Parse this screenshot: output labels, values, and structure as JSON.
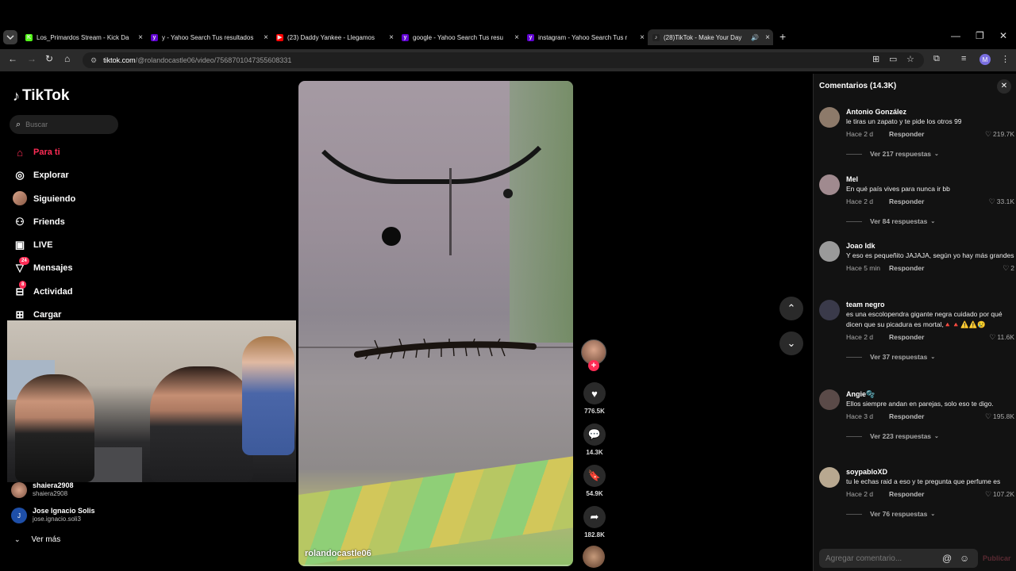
{
  "browser": {
    "tabs": [
      {
        "title": "Los_Primardos Stream - Kick Da",
        "favicon_color": "#53fc18",
        "favicon_glyph": "K"
      },
      {
        "title": "y - Yahoo Search Tus resultados",
        "favicon_color": "#6001d2",
        "favicon_glyph": "y"
      },
      {
        "title": "(23) Daddy Yankee - Llegamos",
        "favicon_color": "#ff0000",
        "favicon_glyph": "▶"
      },
      {
        "title": "google - Yahoo Search Tus resu",
        "favicon_color": "#6001d2",
        "favicon_glyph": "y"
      },
      {
        "title": "instagram - Yahoo Search Tus r",
        "favicon_color": "#6001d2",
        "favicon_glyph": "y"
      },
      {
        "title": "(28)TikTok - Make Your Day",
        "favicon_color": "#222222",
        "favicon_glyph": "♪",
        "active": true
      }
    ],
    "url_host": "tiktok.com",
    "url_path": "/@rolandocastle06/video/7568701047355608331",
    "profile_initial": "M"
  },
  "tiktok": {
    "logo": "TikTok",
    "search_placeholder": "Buscar",
    "nav": [
      {
        "label": "Para ti",
        "icon": "home-icon",
        "active": true
      },
      {
        "label": "Explorar",
        "icon": "compass-icon"
      },
      {
        "label": "Siguiendo",
        "icon": "avatar"
      },
      {
        "label": "Friends",
        "icon": "friends-icon"
      },
      {
        "label": "LIVE",
        "icon": "live-icon"
      },
      {
        "label": "Mensajes",
        "icon": "messages-icon",
        "badge": "24"
      },
      {
        "label": "Actividad",
        "icon": "activity-icon",
        "badge": "8"
      },
      {
        "label": "Cargar",
        "icon": "upload-icon"
      }
    ],
    "following": [
      {
        "name": "shaiera2908",
        "handle": "shaiera2908"
      },
      {
        "name": "Jose Ignacio Solis",
        "handle": "jose.ignacio.soli3",
        "initial": "J"
      }
    ],
    "see_more": "Ver más",
    "video": {
      "caption": "rolandocastle06",
      "likes": "776.5K",
      "comments": "14.3K",
      "saves": "54.9K",
      "shares": "182.8K"
    },
    "comments_panel": {
      "title": "Comentarios (14.3K)",
      "reply_label": "Responder",
      "input_placeholder": "Agregar comentario...",
      "publish_label": "Publicar",
      "items": [
        {
          "user": "Antonio González",
          "text": "le tiras un zapato y te pide los otros 99",
          "when": "Hace 2 d",
          "likes": "219.7K",
          "replies": "Ver 217 respuestas",
          "avatar_color": "#8d7a6a"
        },
        {
          "user": "Mel",
          "text": "En qué país vives para nunca ir bb",
          "when": "Hace 2 d",
          "likes": "33.1K",
          "replies": "Ver 84 respuestas",
          "avatar_color": "#a08a8f"
        },
        {
          "user": "Joao Idk",
          "text": "Y eso es pequeñito JAJAJA, según yo hay más grandes",
          "when": "Hace 5 min",
          "likes": "2",
          "replies": "",
          "avatar_color": "#9a9a9a"
        },
        {
          "user": "team negro",
          "text": "es una escolopendra gigante negra cuidado por qué dicen que su picadura es mortal,🔺🔺⚠️⚠️😢",
          "when": "Hace 2 d",
          "likes": "11.6K",
          "replies": "Ver 37 respuestas",
          "avatar_color": "#3a3a4a"
        },
        {
          "user": "Angie🫧",
          "text": "Ellos siempre andan en parejas, solo eso te digo.",
          "when": "Hace 3 d",
          "likes": "195.8K",
          "replies": "Ver 223 respuestas",
          "avatar_color": "#5a4a48"
        },
        {
          "user": "soypabloXD",
          "text": "tu le echas raid a eso y te pregunta que perfume es",
          "when": "Hace 2 d",
          "likes": "107.2K",
          "replies": "Ver 76 respuestas",
          "avatar_color": "#b8a890"
        }
      ]
    }
  },
  "colors": {
    "accent": "#fe2c55",
    "panel_bg": "#121212"
  }
}
